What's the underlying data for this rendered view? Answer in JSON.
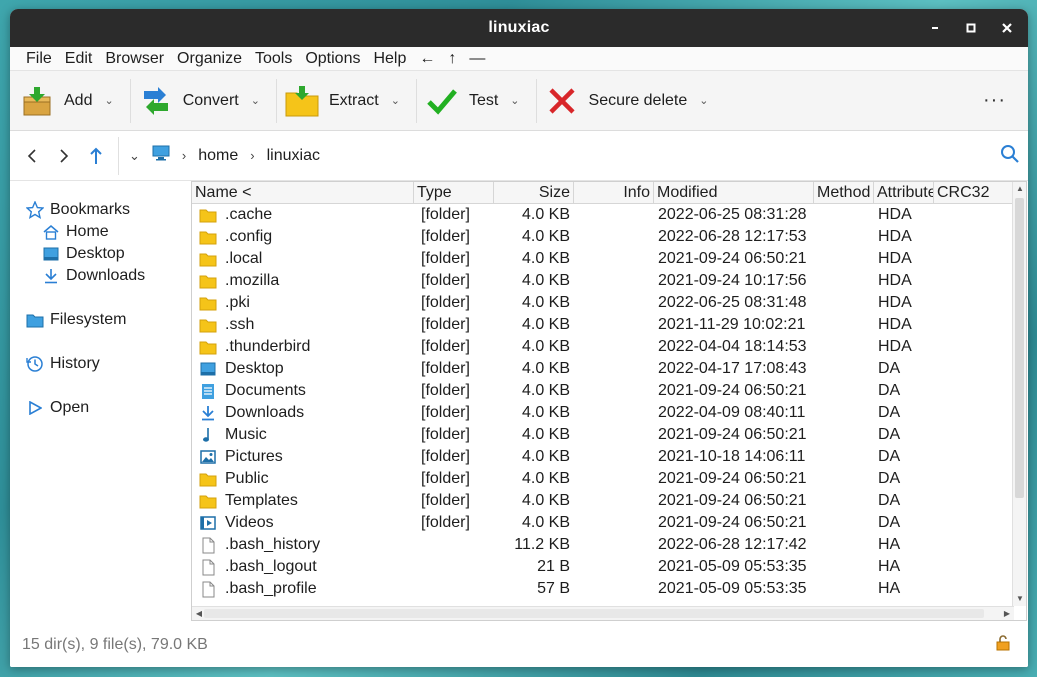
{
  "window": {
    "title": "linuxiac"
  },
  "menu": [
    "File",
    "Edit",
    "Browser",
    "Organize",
    "Tools",
    "Options",
    "Help",
    "←",
    "↑",
    "—"
  ],
  "toolbar": {
    "buttons": [
      {
        "label": "Add",
        "icon": "add-archive-icon"
      },
      {
        "label": "Convert",
        "icon": "convert-icon"
      },
      {
        "label": "Extract",
        "icon": "extract-folder-icon"
      },
      {
        "label": "Test",
        "icon": "checkmark-icon"
      },
      {
        "label": "Secure delete",
        "icon": "red-x-icon"
      }
    ],
    "overflow": "···"
  },
  "navbar": {
    "path": [
      "home",
      "linuxiac"
    ]
  },
  "sidebar": {
    "bookmarks": "Bookmarks",
    "bookmark_items": [
      "Home",
      "Desktop",
      "Downloads"
    ],
    "filesystem": "Filesystem",
    "history": "History",
    "open": "Open"
  },
  "columns": [
    "Name <",
    "Type",
    "Size",
    "Info",
    "Modified",
    "Method",
    "Attributes",
    "CRC32"
  ],
  "rows": [
    {
      "name": ".cache",
      "type": "[folder]",
      "size": "4.0 KB",
      "modified": "2022-06-25 08:31:28",
      "attr": "HDA",
      "icon": "folder-icon"
    },
    {
      "name": ".config",
      "type": "[folder]",
      "size": "4.0 KB",
      "modified": "2022-06-28 12:17:53",
      "attr": "HDA",
      "icon": "folder-icon"
    },
    {
      "name": ".local",
      "type": "[folder]",
      "size": "4.0 KB",
      "modified": "2021-09-24 06:50:21",
      "attr": "HDA",
      "icon": "folder-icon"
    },
    {
      "name": ".mozilla",
      "type": "[folder]",
      "size": "4.0 KB",
      "modified": "2021-09-24 10:17:56",
      "attr": "HDA",
      "icon": "folder-icon"
    },
    {
      "name": ".pki",
      "type": "[folder]",
      "size": "4.0 KB",
      "modified": "2022-06-25 08:31:48",
      "attr": "HDA",
      "icon": "folder-icon"
    },
    {
      "name": ".ssh",
      "type": "[folder]",
      "size": "4.0 KB",
      "modified": "2021-11-29 10:02:21",
      "attr": "HDA",
      "icon": "folder-icon"
    },
    {
      "name": ".thunderbird",
      "type": "[folder]",
      "size": "4.0 KB",
      "modified": "2022-04-04 18:14:53",
      "attr": "HDA",
      "icon": "folder-icon"
    },
    {
      "name": "Desktop",
      "type": "[folder]",
      "size": "4.0 KB",
      "modified": "2022-04-17 17:08:43",
      "attr": "DA",
      "icon": "desktop-folder-icon"
    },
    {
      "name": "Documents",
      "type": "[folder]",
      "size": "4.0 KB",
      "modified": "2021-09-24 06:50:21",
      "attr": "DA",
      "icon": "documents-folder-icon"
    },
    {
      "name": "Downloads",
      "type": "[folder]",
      "size": "4.0 KB",
      "modified": "2022-04-09 08:40:11",
      "attr": "DA",
      "icon": "downloads-folder-icon"
    },
    {
      "name": "Music",
      "type": "[folder]",
      "size": "4.0 KB",
      "modified": "2021-09-24 06:50:21",
      "attr": "DA",
      "icon": "music-folder-icon"
    },
    {
      "name": "Pictures",
      "type": "[folder]",
      "size": "4.0 KB",
      "modified": "2021-10-18 14:06:11",
      "attr": "DA",
      "icon": "pictures-folder-icon"
    },
    {
      "name": "Public",
      "type": "[folder]",
      "size": "4.0 KB",
      "modified": "2021-09-24 06:50:21",
      "attr": "DA",
      "icon": "folder-icon"
    },
    {
      "name": "Templates",
      "type": "[folder]",
      "size": "4.0 KB",
      "modified": "2021-09-24 06:50:21",
      "attr": "DA",
      "icon": "folder-icon"
    },
    {
      "name": "Videos",
      "type": "[folder]",
      "size": "4.0 KB",
      "modified": "2021-09-24 06:50:21",
      "attr": "DA",
      "icon": "videos-folder-icon"
    },
    {
      "name": ".bash_history",
      "type": "",
      "size": "11.2 KB",
      "modified": "2022-06-28 12:17:42",
      "attr": "HA",
      "icon": "file-icon"
    },
    {
      "name": ".bash_logout",
      "type": "",
      "size": "21 B",
      "modified": "2021-05-09 05:53:35",
      "attr": "HA",
      "icon": "file-icon"
    },
    {
      "name": ".bash_profile",
      "type": "",
      "size": "57 B",
      "modified": "2021-05-09 05:53:35",
      "attr": "HA",
      "icon": "file-icon"
    }
  ],
  "status": "15 dir(s), 9 file(s), 79.0 KB",
  "colors": {
    "folder": "#f5c419",
    "accent": "#2a7fd4",
    "titlebar": "#2b2b2b"
  }
}
